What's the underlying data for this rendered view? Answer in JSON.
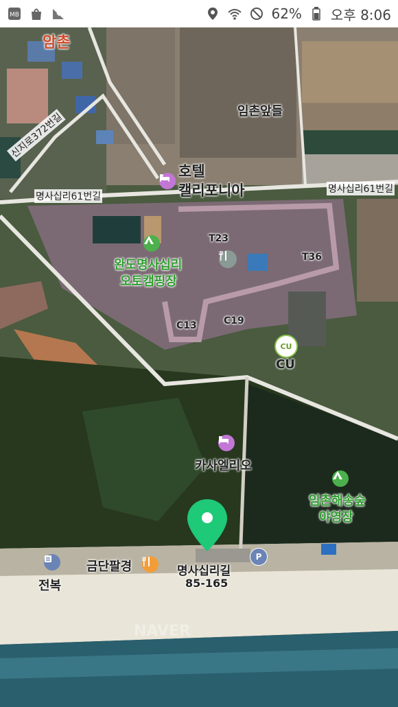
{
  "status_bar": {
    "battery": "62%",
    "time": "오후 8:06",
    "icons": [
      "app-icon",
      "shopping-bag-icon",
      "checkmark-icon",
      "location-icon",
      "wifi-icon",
      "no-entry-icon",
      "battery-icon"
    ]
  },
  "map": {
    "watermark": "NAVER",
    "places": {
      "village": "암촌",
      "field": "임촌앞들",
      "hotel_line1": "호텔",
      "hotel_line2": "캘리포니아",
      "road_1": "명사십리61번길",
      "road_2": "명사십리61번길",
      "road_3": "신지로372번길",
      "camp_line1": "완도명사십리",
      "camp_line2": "오토캠핑장",
      "site_t23": "T23",
      "site_t36": "T36",
      "site_c13": "C13",
      "site_c19": "C19",
      "cu_label": "CU",
      "cu_badge": "CU",
      "casaelio": "카사엘리오",
      "forest_camp_line1": "임촌해송숲",
      "forest_camp_line2": "야영장",
      "restaurant": "금단팔경",
      "address_line1": "명사십리길",
      "address_line2": "85-165",
      "jeonbok": "전복",
      "parking": "P"
    }
  },
  "colors": {
    "road": "#e8e6e0",
    "sea": "#2a5f6e",
    "sand": "#e9e5d8",
    "forest": "#27381f",
    "marker": "#1ec978",
    "poi_pink": "#c277d6",
    "poi_green": "#4cb04c",
    "poi_orange": "#f29d38",
    "poi_blue": "#6b84b6",
    "label_green": "#2f9d2f"
  }
}
